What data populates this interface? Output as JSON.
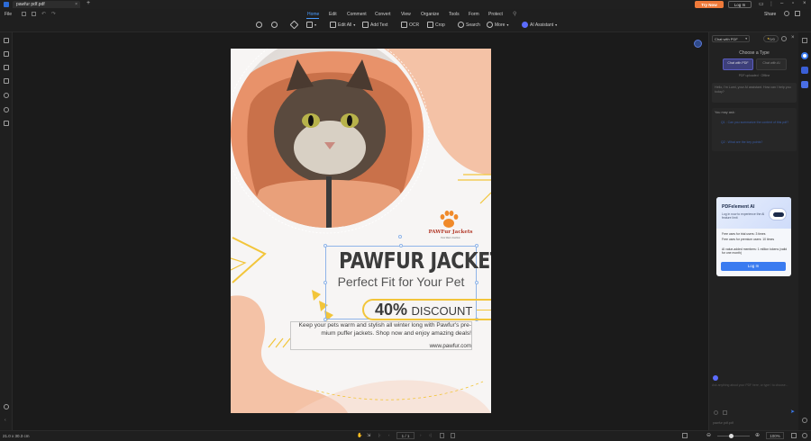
{
  "titlebar": {
    "tab_title": "pawfur pdf.pdf",
    "tab_close": "×",
    "new_tab": "+",
    "try_now": "Try Now",
    "log_in": "Log In"
  },
  "menubar": {
    "file": "File",
    "items": [
      "Home",
      "Edit",
      "Comment",
      "Convert",
      "View",
      "Organize",
      "Tools",
      "Form",
      "Protect"
    ],
    "share": "Share"
  },
  "toolbar": {
    "edit_all": "Edit All",
    "add_text": "Add Text",
    "ocr": "OCR",
    "crop": "Crop",
    "search": "Search",
    "more": "More",
    "ai_assistant": "AI Assistant"
  },
  "document": {
    "brand_name": "PAWFur Jackets",
    "brand_tagline": "Pets Warm Fashion",
    "headline": "PAWFUR JACKETS",
    "subheadline": "Perfect Fit for Your Pet",
    "discount_value": "40%",
    "discount_label": "DISCOUNT",
    "body_text": "Keep your pets warm and stylish all winter long with Pawfur's pre-mium puffer jackets. Shop now and enjoy amazing deals!",
    "website": "www.pawfur.com"
  },
  "ai_panel": {
    "mode": "Chat with PDF",
    "counter": "0/0",
    "choose_type": "Choose a Type",
    "type_options": [
      "Chat with PDF",
      "Chat with AI"
    ],
    "pdf_status": "PDF uploaded · Offline",
    "greeting": "Hello, I'm Lumi, your AI assistant. How can I help you today?",
    "you_may_ask": "You may ask:",
    "suggestions": [
      "Q1 : Can you summarize the content of this pdf?",
      "Q2 : What are the key points?"
    ],
    "input_placeholder": "Ask anything about your PDF here, or type / to choose...",
    "file_label": "pawfur pdf.pdf",
    "promo": {
      "title": "PDFelement AI",
      "desc": "Log in now to experience the AI feature limit",
      "bullets": [
        "Free uses for trial users: 3 times",
        "Free uses for premium users: 10 times",
        "AI value-added members: 1 million tokens (valid for one month)"
      ],
      "button": "Log In"
    }
  },
  "statusbar": {
    "page_size": "21.0 x 30.3 cm",
    "page_indicator": "1 / 1",
    "zoom": "100%"
  },
  "colors": {
    "accent": "#4a9cff",
    "try_now": "#f07a3a",
    "peach": "#f4c2a6",
    "yellow": "#f2c53a",
    "dark_text": "#3b3b3b",
    "orange_logo": "#f08a2a"
  }
}
